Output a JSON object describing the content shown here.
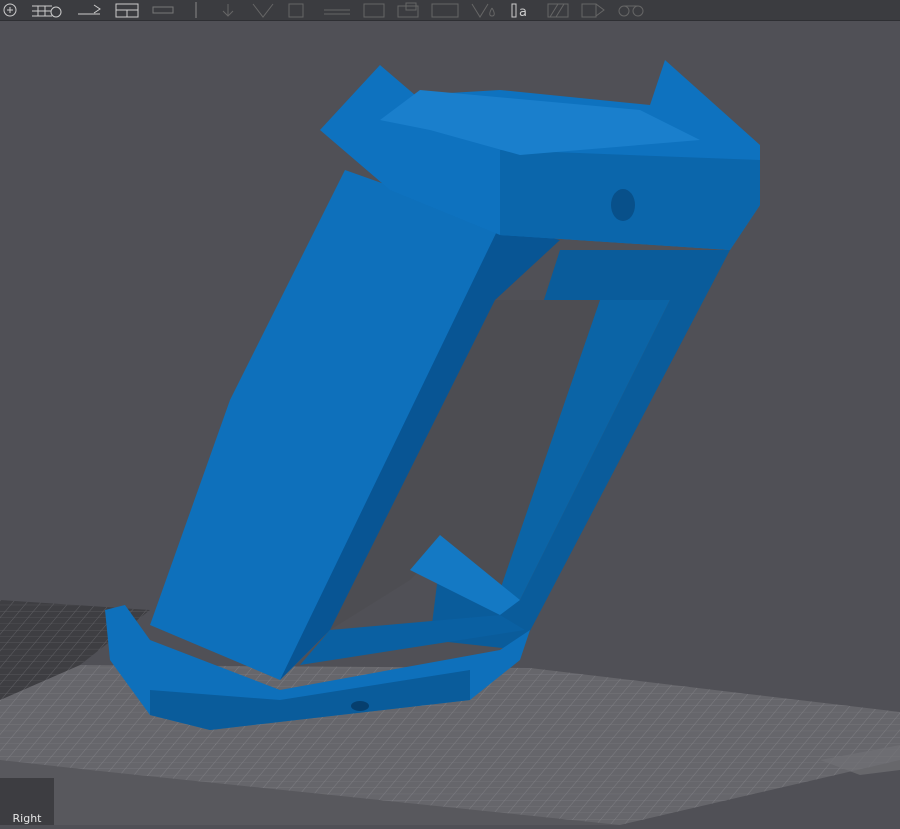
{
  "toolbar": {
    "icons": [
      "add-object-icon",
      "add-plate-icon",
      "arrange-icon",
      "split-view-icon",
      "layer-icon",
      "drop-to-bed-icon",
      "cut-icon",
      "support-paint-icon",
      "seam-icon",
      "assembly-icon",
      "box-icon",
      "shape-icon",
      "color-paint-icon",
      "text-icon",
      "hatch-icon",
      "measure-icon",
      "scale-icon"
    ]
  },
  "viewport": {
    "view_label": "Right",
    "model_color": "#0d6db5",
    "model_shadow_color": "#08508a",
    "plate_color": "#6b6b70"
  }
}
